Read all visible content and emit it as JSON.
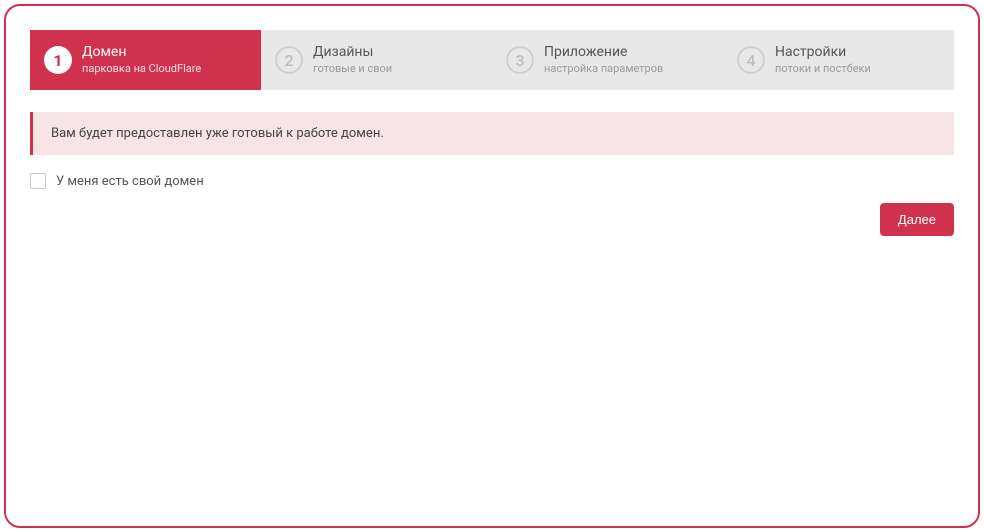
{
  "steps": [
    {
      "num": "1",
      "title": "Домен",
      "sub": "парковка на CloudFlare",
      "active": true
    },
    {
      "num": "2",
      "title": "Дизайны",
      "sub": "готовые и свои",
      "active": false
    },
    {
      "num": "3",
      "title": "Приложение",
      "sub": "настройка параметров",
      "active": false
    },
    {
      "num": "4",
      "title": "Настройки",
      "sub": "потоки и постбеки",
      "active": false
    }
  ],
  "info_text": "Вам будет предоставлен уже готовый к работе домен.",
  "checkbox_label": "У меня есть свой домен",
  "next_button": "Далее"
}
